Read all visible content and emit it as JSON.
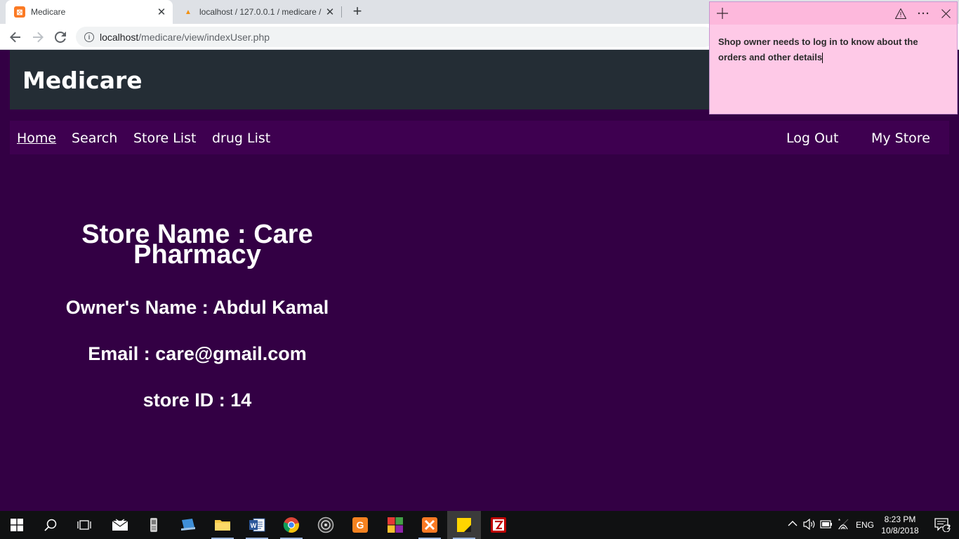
{
  "browser": {
    "tabs": [
      {
        "title": "Medicare",
        "favicon": "xampp-icon",
        "active": true
      },
      {
        "title": "localhost / 127.0.0.1 / medicare /",
        "favicon": "phpmyadmin-icon",
        "active": false
      }
    ],
    "url_host": "localhost",
    "url_path": "/medicare/view/indexUser.php"
  },
  "site": {
    "title": "Medicare",
    "nav": {
      "left": [
        "Home",
        "Search",
        "Store List",
        "drug List"
      ],
      "right": [
        "Log Out",
        "My Store"
      ]
    }
  },
  "store": {
    "name_line1": "Store Name : Care",
    "name_line2": "Pharmacy",
    "owner": "Owner's Name : Abdul Kamal",
    "email": "Email : care@gmail.com",
    "id": "store ID : 14"
  },
  "sticky_note": {
    "text": "Shop owner needs to log in to know about the orders and other details"
  },
  "taskbar": {
    "apps": [
      "start-icon",
      "search-icon",
      "task-view-icon",
      "mail-icon",
      "device-icon",
      "network-app-icon",
      "file-explorer-icon",
      "word-icon",
      "chrome-icon",
      "media-icon",
      "pdf-app-icon",
      "games-icon",
      "xampp-icon",
      "sticky-notes-icon",
      "filezilla-icon"
    ],
    "language": "ENG",
    "time": "8:23 PM",
    "date": "10/8/2018",
    "notification_count": "2"
  },
  "colors": {
    "page_bg": "#330044",
    "header_bg": "#242d35",
    "nav_bg": "#3e0050",
    "sticky_bg": "#fec9e7"
  }
}
